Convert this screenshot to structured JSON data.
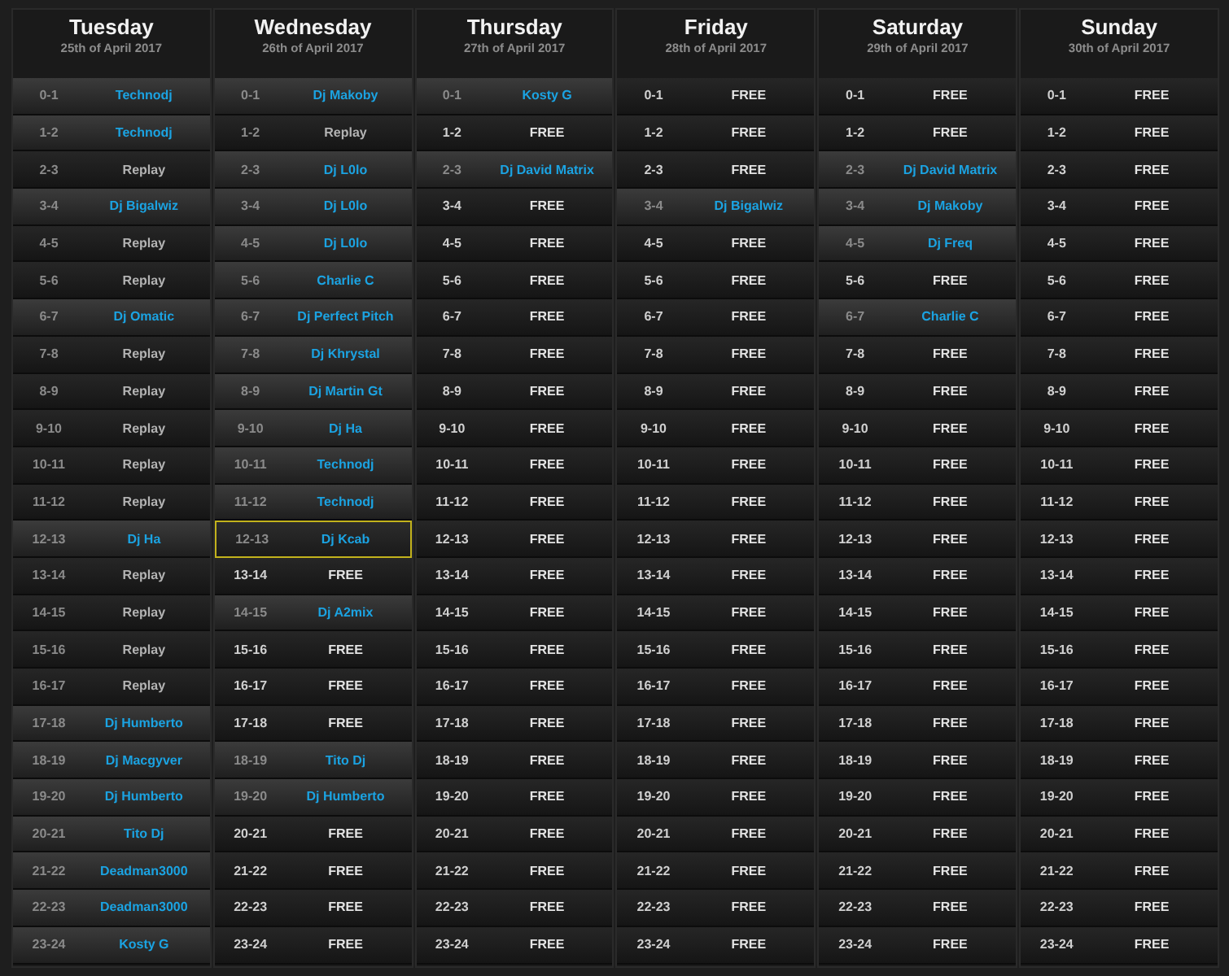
{
  "days": [
    {
      "title": "Tuesday",
      "date": "25th of April 2017",
      "slots": [
        {
          "hour": "0-1",
          "name": "Technodj",
          "kind": "dj",
          "selected": false
        },
        {
          "hour": "1-2",
          "name": "Technodj",
          "kind": "dj",
          "selected": false
        },
        {
          "hour": "2-3",
          "name": "Replay",
          "kind": "replay",
          "selected": false
        },
        {
          "hour": "3-4",
          "name": "Dj Bigalwiz",
          "kind": "dj",
          "selected": false
        },
        {
          "hour": "4-5",
          "name": "Replay",
          "kind": "replay",
          "selected": false
        },
        {
          "hour": "5-6",
          "name": "Replay",
          "kind": "replay",
          "selected": false
        },
        {
          "hour": "6-7",
          "name": "Dj Omatic",
          "kind": "dj",
          "selected": false
        },
        {
          "hour": "7-8",
          "name": "Replay",
          "kind": "replay",
          "selected": false
        },
        {
          "hour": "8-9",
          "name": "Replay",
          "kind": "replay",
          "selected": false
        },
        {
          "hour": "9-10",
          "name": "Replay",
          "kind": "replay",
          "selected": false
        },
        {
          "hour": "10-11",
          "name": "Replay",
          "kind": "replay",
          "selected": false
        },
        {
          "hour": "11-12",
          "name": "Replay",
          "kind": "replay",
          "selected": false
        },
        {
          "hour": "12-13",
          "name": "Dj Ha",
          "kind": "dj",
          "selected": false
        },
        {
          "hour": "13-14",
          "name": "Replay",
          "kind": "replay",
          "selected": false
        },
        {
          "hour": "14-15",
          "name": "Replay",
          "kind": "replay",
          "selected": false
        },
        {
          "hour": "15-16",
          "name": "Replay",
          "kind": "replay",
          "selected": false
        },
        {
          "hour": "16-17",
          "name": "Replay",
          "kind": "replay",
          "selected": false
        },
        {
          "hour": "17-18",
          "name": "Dj Humberto",
          "kind": "dj",
          "selected": false
        },
        {
          "hour": "18-19",
          "name": "Dj Macgyver",
          "kind": "dj",
          "selected": false
        },
        {
          "hour": "19-20",
          "name": "Dj Humberto",
          "kind": "dj",
          "selected": false
        },
        {
          "hour": "20-21",
          "name": "Tito Dj",
          "kind": "dj",
          "selected": false
        },
        {
          "hour": "21-22",
          "name": "Deadman3000",
          "kind": "dj",
          "selected": false
        },
        {
          "hour": "22-23",
          "name": "Deadman3000",
          "kind": "dj",
          "selected": false
        },
        {
          "hour": "23-24",
          "name": "Kosty G",
          "kind": "dj",
          "selected": false
        }
      ]
    },
    {
      "title": "Wednesday",
      "date": "26th of April 2017",
      "slots": [
        {
          "hour": "0-1",
          "name": "Dj Makoby",
          "kind": "dj",
          "selected": false
        },
        {
          "hour": "1-2",
          "name": "Replay",
          "kind": "replay",
          "selected": false
        },
        {
          "hour": "2-3",
          "name": "Dj L0lo",
          "kind": "dj",
          "selected": false
        },
        {
          "hour": "3-4",
          "name": "Dj L0lo",
          "kind": "dj",
          "selected": false
        },
        {
          "hour": "4-5",
          "name": "Dj L0lo",
          "kind": "dj",
          "selected": false
        },
        {
          "hour": "5-6",
          "name": "Charlie C",
          "kind": "dj",
          "selected": false
        },
        {
          "hour": "6-7",
          "name": "Dj Perfect Pitch",
          "kind": "dj",
          "selected": false
        },
        {
          "hour": "7-8",
          "name": "Dj Khrystal",
          "kind": "dj",
          "selected": false
        },
        {
          "hour": "8-9",
          "name": "Dj Martin Gt",
          "kind": "dj",
          "selected": false
        },
        {
          "hour": "9-10",
          "name": "Dj Ha",
          "kind": "dj",
          "selected": false
        },
        {
          "hour": "10-11",
          "name": "Technodj",
          "kind": "dj",
          "selected": false
        },
        {
          "hour": "11-12",
          "name": "Technodj",
          "kind": "dj",
          "selected": false
        },
        {
          "hour": "12-13",
          "name": "Dj Kcab",
          "kind": "dj",
          "selected": true
        },
        {
          "hour": "13-14",
          "name": "FREE",
          "kind": "free",
          "selected": false
        },
        {
          "hour": "14-15",
          "name": "Dj A2mix",
          "kind": "dj",
          "selected": false
        },
        {
          "hour": "15-16",
          "name": "FREE",
          "kind": "free",
          "selected": false
        },
        {
          "hour": "16-17",
          "name": "FREE",
          "kind": "free",
          "selected": false
        },
        {
          "hour": "17-18",
          "name": "FREE",
          "kind": "free",
          "selected": false
        },
        {
          "hour": "18-19",
          "name": "Tito Dj",
          "kind": "dj",
          "selected": false
        },
        {
          "hour": "19-20",
          "name": "Dj Humberto",
          "kind": "dj",
          "selected": false
        },
        {
          "hour": "20-21",
          "name": "FREE",
          "kind": "free",
          "selected": false
        },
        {
          "hour": "21-22",
          "name": "FREE",
          "kind": "free",
          "selected": false
        },
        {
          "hour": "22-23",
          "name": "FREE",
          "kind": "free",
          "selected": false
        },
        {
          "hour": "23-24",
          "name": "FREE",
          "kind": "free",
          "selected": false
        }
      ]
    },
    {
      "title": "Thursday",
      "date": "27th of April 2017",
      "slots": [
        {
          "hour": "0-1",
          "name": "Kosty G",
          "kind": "dj",
          "selected": false
        },
        {
          "hour": "1-2",
          "name": "FREE",
          "kind": "free",
          "selected": false
        },
        {
          "hour": "2-3",
          "name": "Dj David Matrix",
          "kind": "dj",
          "selected": false
        },
        {
          "hour": "3-4",
          "name": "FREE",
          "kind": "free",
          "selected": false
        },
        {
          "hour": "4-5",
          "name": "FREE",
          "kind": "free",
          "selected": false
        },
        {
          "hour": "5-6",
          "name": "FREE",
          "kind": "free",
          "selected": false
        },
        {
          "hour": "6-7",
          "name": "FREE",
          "kind": "free",
          "selected": false
        },
        {
          "hour": "7-8",
          "name": "FREE",
          "kind": "free",
          "selected": false
        },
        {
          "hour": "8-9",
          "name": "FREE",
          "kind": "free",
          "selected": false
        },
        {
          "hour": "9-10",
          "name": "FREE",
          "kind": "free",
          "selected": false
        },
        {
          "hour": "10-11",
          "name": "FREE",
          "kind": "free",
          "selected": false
        },
        {
          "hour": "11-12",
          "name": "FREE",
          "kind": "free",
          "selected": false
        },
        {
          "hour": "12-13",
          "name": "FREE",
          "kind": "free",
          "selected": false
        },
        {
          "hour": "13-14",
          "name": "FREE",
          "kind": "free",
          "selected": false
        },
        {
          "hour": "14-15",
          "name": "FREE",
          "kind": "free",
          "selected": false
        },
        {
          "hour": "15-16",
          "name": "FREE",
          "kind": "free",
          "selected": false
        },
        {
          "hour": "16-17",
          "name": "FREE",
          "kind": "free",
          "selected": false
        },
        {
          "hour": "17-18",
          "name": "FREE",
          "kind": "free",
          "selected": false
        },
        {
          "hour": "18-19",
          "name": "FREE",
          "kind": "free",
          "selected": false
        },
        {
          "hour": "19-20",
          "name": "FREE",
          "kind": "free",
          "selected": false
        },
        {
          "hour": "20-21",
          "name": "FREE",
          "kind": "free",
          "selected": false
        },
        {
          "hour": "21-22",
          "name": "FREE",
          "kind": "free",
          "selected": false
        },
        {
          "hour": "22-23",
          "name": "FREE",
          "kind": "free",
          "selected": false
        },
        {
          "hour": "23-24",
          "name": "FREE",
          "kind": "free",
          "selected": false
        }
      ]
    },
    {
      "title": "Friday",
      "date": "28th of April 2017",
      "slots": [
        {
          "hour": "0-1",
          "name": "FREE",
          "kind": "free",
          "selected": false
        },
        {
          "hour": "1-2",
          "name": "FREE",
          "kind": "free",
          "selected": false
        },
        {
          "hour": "2-3",
          "name": "FREE",
          "kind": "free",
          "selected": false
        },
        {
          "hour": "3-4",
          "name": "Dj Bigalwiz",
          "kind": "dj",
          "selected": false
        },
        {
          "hour": "4-5",
          "name": "FREE",
          "kind": "free",
          "selected": false
        },
        {
          "hour": "5-6",
          "name": "FREE",
          "kind": "free",
          "selected": false
        },
        {
          "hour": "6-7",
          "name": "FREE",
          "kind": "free",
          "selected": false
        },
        {
          "hour": "7-8",
          "name": "FREE",
          "kind": "free",
          "selected": false
        },
        {
          "hour": "8-9",
          "name": "FREE",
          "kind": "free",
          "selected": false
        },
        {
          "hour": "9-10",
          "name": "FREE",
          "kind": "free",
          "selected": false
        },
        {
          "hour": "10-11",
          "name": "FREE",
          "kind": "free",
          "selected": false
        },
        {
          "hour": "11-12",
          "name": "FREE",
          "kind": "free",
          "selected": false
        },
        {
          "hour": "12-13",
          "name": "FREE",
          "kind": "free",
          "selected": false
        },
        {
          "hour": "13-14",
          "name": "FREE",
          "kind": "free",
          "selected": false
        },
        {
          "hour": "14-15",
          "name": "FREE",
          "kind": "free",
          "selected": false
        },
        {
          "hour": "15-16",
          "name": "FREE",
          "kind": "free",
          "selected": false
        },
        {
          "hour": "16-17",
          "name": "FREE",
          "kind": "free",
          "selected": false
        },
        {
          "hour": "17-18",
          "name": "FREE",
          "kind": "free",
          "selected": false
        },
        {
          "hour": "18-19",
          "name": "FREE",
          "kind": "free",
          "selected": false
        },
        {
          "hour": "19-20",
          "name": "FREE",
          "kind": "free",
          "selected": false
        },
        {
          "hour": "20-21",
          "name": "FREE",
          "kind": "free",
          "selected": false
        },
        {
          "hour": "21-22",
          "name": "FREE",
          "kind": "free",
          "selected": false
        },
        {
          "hour": "22-23",
          "name": "FREE",
          "kind": "free",
          "selected": false
        },
        {
          "hour": "23-24",
          "name": "FREE",
          "kind": "free",
          "selected": false
        }
      ]
    },
    {
      "title": "Saturday",
      "date": "29th of April 2017",
      "slots": [
        {
          "hour": "0-1",
          "name": "FREE",
          "kind": "free",
          "selected": false
        },
        {
          "hour": "1-2",
          "name": "FREE",
          "kind": "free",
          "selected": false
        },
        {
          "hour": "2-3",
          "name": "Dj David Matrix",
          "kind": "dj",
          "selected": false
        },
        {
          "hour": "3-4",
          "name": "Dj Makoby",
          "kind": "dj",
          "selected": false
        },
        {
          "hour": "4-5",
          "name": "Dj Freq",
          "kind": "dj",
          "selected": false
        },
        {
          "hour": "5-6",
          "name": "FREE",
          "kind": "free",
          "selected": false
        },
        {
          "hour": "6-7",
          "name": "Charlie C",
          "kind": "dj",
          "selected": false
        },
        {
          "hour": "7-8",
          "name": "FREE",
          "kind": "free",
          "selected": false
        },
        {
          "hour": "8-9",
          "name": "FREE",
          "kind": "free",
          "selected": false
        },
        {
          "hour": "9-10",
          "name": "FREE",
          "kind": "free",
          "selected": false
        },
        {
          "hour": "10-11",
          "name": "FREE",
          "kind": "free",
          "selected": false
        },
        {
          "hour": "11-12",
          "name": "FREE",
          "kind": "free",
          "selected": false
        },
        {
          "hour": "12-13",
          "name": "FREE",
          "kind": "free",
          "selected": false
        },
        {
          "hour": "13-14",
          "name": "FREE",
          "kind": "free",
          "selected": false
        },
        {
          "hour": "14-15",
          "name": "FREE",
          "kind": "free",
          "selected": false
        },
        {
          "hour": "15-16",
          "name": "FREE",
          "kind": "free",
          "selected": false
        },
        {
          "hour": "16-17",
          "name": "FREE",
          "kind": "free",
          "selected": false
        },
        {
          "hour": "17-18",
          "name": "FREE",
          "kind": "free",
          "selected": false
        },
        {
          "hour": "18-19",
          "name": "FREE",
          "kind": "free",
          "selected": false
        },
        {
          "hour": "19-20",
          "name": "FREE",
          "kind": "free",
          "selected": false
        },
        {
          "hour": "20-21",
          "name": "FREE",
          "kind": "free",
          "selected": false
        },
        {
          "hour": "21-22",
          "name": "FREE",
          "kind": "free",
          "selected": false
        },
        {
          "hour": "22-23",
          "name": "FREE",
          "kind": "free",
          "selected": false
        },
        {
          "hour": "23-24",
          "name": "FREE",
          "kind": "free",
          "selected": false
        }
      ]
    },
    {
      "title": "Sunday",
      "date": "30th of April 2017",
      "slots": [
        {
          "hour": "0-1",
          "name": "FREE",
          "kind": "free",
          "selected": false
        },
        {
          "hour": "1-2",
          "name": "FREE",
          "kind": "free",
          "selected": false
        },
        {
          "hour": "2-3",
          "name": "FREE",
          "kind": "free",
          "selected": false
        },
        {
          "hour": "3-4",
          "name": "FREE",
          "kind": "free",
          "selected": false
        },
        {
          "hour": "4-5",
          "name": "FREE",
          "kind": "free",
          "selected": false
        },
        {
          "hour": "5-6",
          "name": "FREE",
          "kind": "free",
          "selected": false
        },
        {
          "hour": "6-7",
          "name": "FREE",
          "kind": "free",
          "selected": false
        },
        {
          "hour": "7-8",
          "name": "FREE",
          "kind": "free",
          "selected": false
        },
        {
          "hour": "8-9",
          "name": "FREE",
          "kind": "free",
          "selected": false
        },
        {
          "hour": "9-10",
          "name": "FREE",
          "kind": "free",
          "selected": false
        },
        {
          "hour": "10-11",
          "name": "FREE",
          "kind": "free",
          "selected": false
        },
        {
          "hour": "11-12",
          "name": "FREE",
          "kind": "free",
          "selected": false
        },
        {
          "hour": "12-13",
          "name": "FREE",
          "kind": "free",
          "selected": false
        },
        {
          "hour": "13-14",
          "name": "FREE",
          "kind": "free",
          "selected": false
        },
        {
          "hour": "14-15",
          "name": "FREE",
          "kind": "free",
          "selected": false
        },
        {
          "hour": "15-16",
          "name": "FREE",
          "kind": "free",
          "selected": false
        },
        {
          "hour": "16-17",
          "name": "FREE",
          "kind": "free",
          "selected": false
        },
        {
          "hour": "17-18",
          "name": "FREE",
          "kind": "free",
          "selected": false
        },
        {
          "hour": "18-19",
          "name": "FREE",
          "kind": "free",
          "selected": false
        },
        {
          "hour": "19-20",
          "name": "FREE",
          "kind": "free",
          "selected": false
        },
        {
          "hour": "20-21",
          "name": "FREE",
          "kind": "free",
          "selected": false
        },
        {
          "hour": "21-22",
          "name": "FREE",
          "kind": "free",
          "selected": false
        },
        {
          "hour": "22-23",
          "name": "FREE",
          "kind": "free",
          "selected": false
        },
        {
          "hour": "23-24",
          "name": "FREE",
          "kind": "free",
          "selected": false
        }
      ]
    }
  ]
}
